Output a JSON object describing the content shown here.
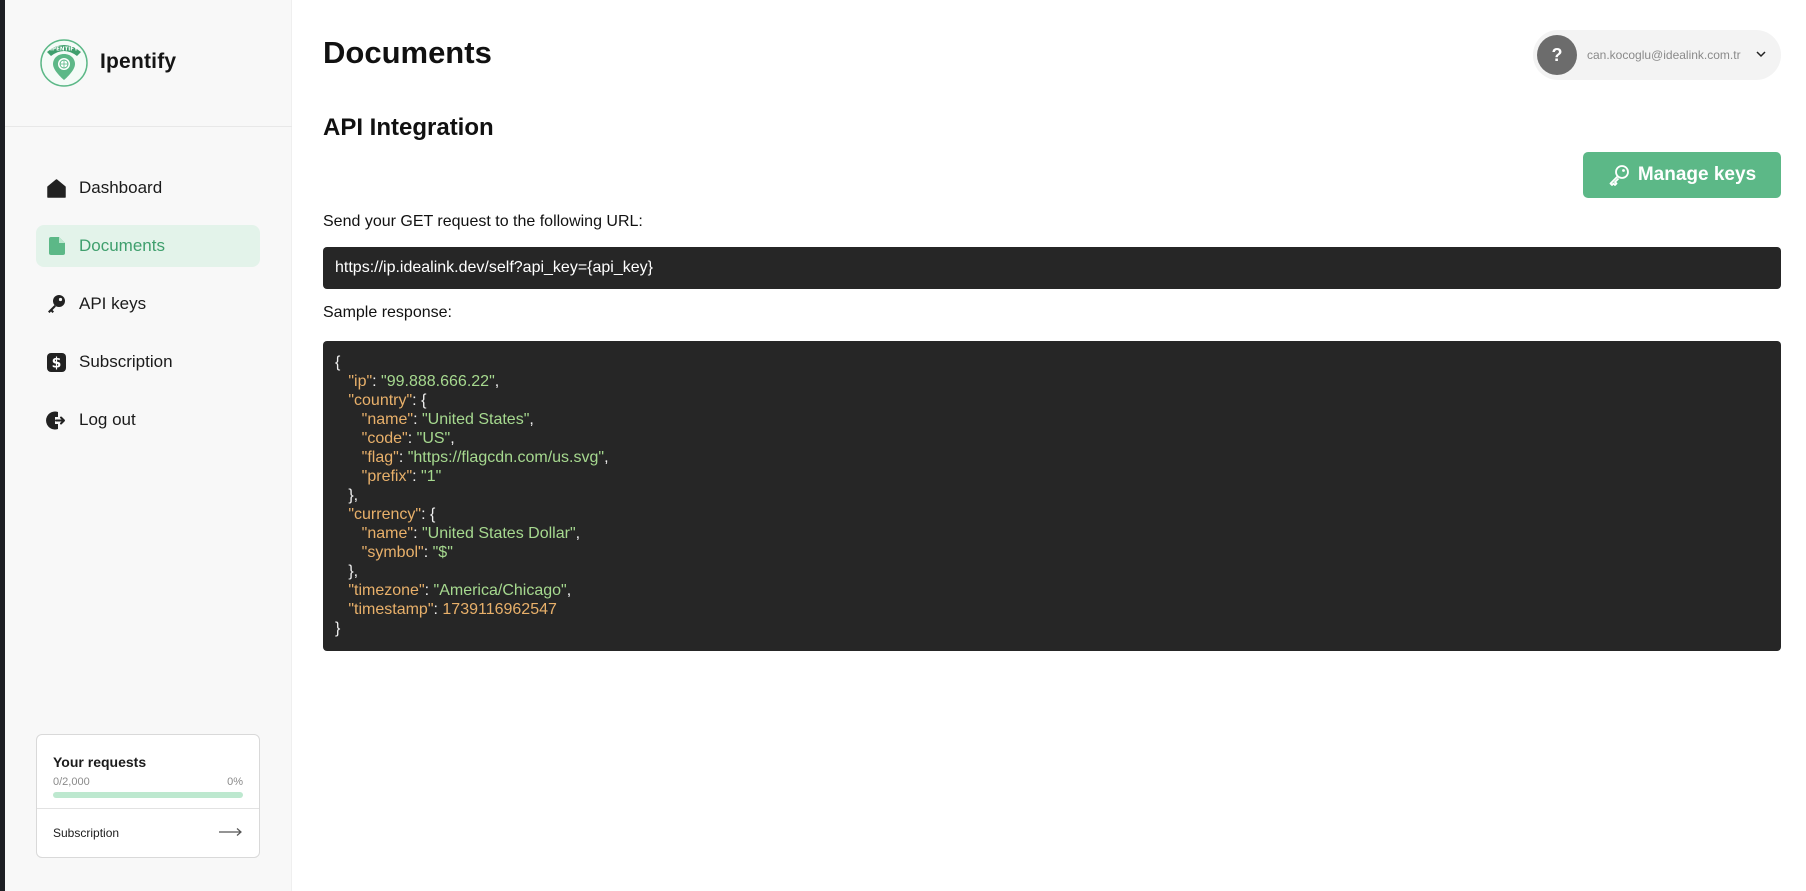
{
  "brand": {
    "name": "Ipentify",
    "logo_text": "IPENTIFY"
  },
  "nav": {
    "items": [
      {
        "label": "Dashboard",
        "icon": "home-icon"
      },
      {
        "label": "Documents",
        "icon": "document-icon",
        "active": true
      },
      {
        "label": "API keys",
        "icon": "key-icon"
      },
      {
        "label": "Subscription",
        "icon": "dollar-icon"
      },
      {
        "label": "Log out",
        "icon": "logout-icon"
      }
    ]
  },
  "usage": {
    "title": "Your requests",
    "count": "0/2,000",
    "percent": "0%",
    "progress": 0,
    "link_label": "Subscription",
    "link_icon": "arrow-right-icon"
  },
  "header": {
    "title": "Documents",
    "account_email": "can.kocoglu@idealink.com.tr",
    "avatar_text": "?"
  },
  "content": {
    "section_title": "API Integration",
    "manage_keys_label": "Manage keys",
    "request_label": "Send your GET request to the following URL:",
    "url": "https://ip.idealink.dev/self?api_key={api_key}",
    "sample_label": "Sample response:",
    "sample_response": {
      "ip": "99.888.666.22",
      "country_name": "United States",
      "country_code": "US",
      "country_flag": "https://flagcdn.com/us.svg",
      "country_prefix": "1",
      "currency_name": "United States Dollar",
      "currency_symbol": "$",
      "timezone": "America/Chicago",
      "timestamp": "1739116962547"
    }
  },
  "colors": {
    "accent": "#5cb887",
    "active_bg": "#e3f3ea",
    "code_bg": "#262626",
    "code_key": "#e8b06a",
    "code_string": "#a6d98f"
  }
}
